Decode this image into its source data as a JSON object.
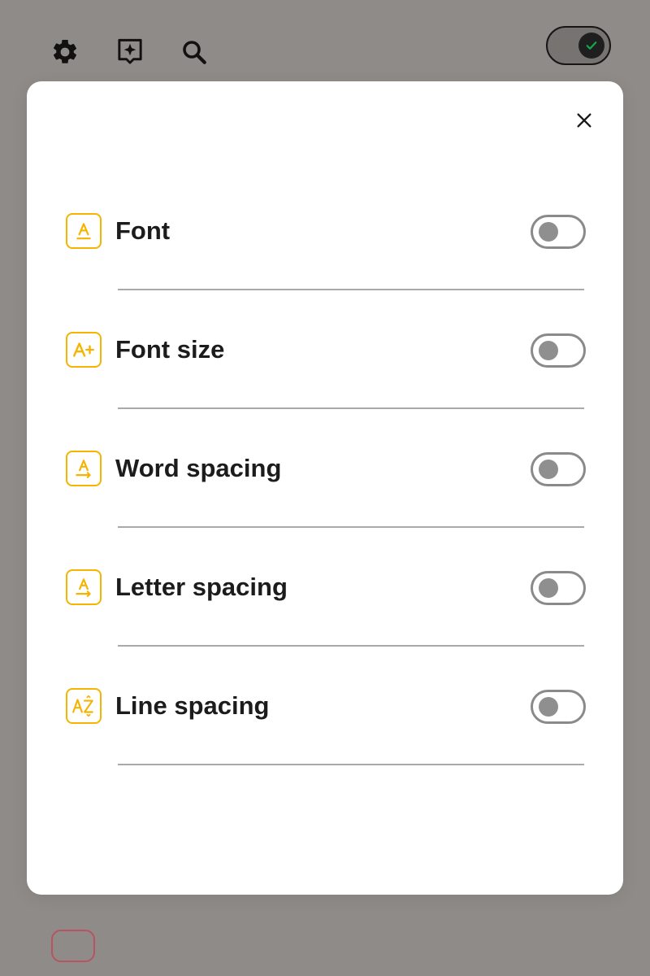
{
  "toolbar": {
    "icons": [
      "gear-icon",
      "ai-assist-icon",
      "search-icon"
    ],
    "toggle": {
      "state": "on",
      "icon": "check-icon"
    }
  },
  "modal": {
    "close_icon": "close-icon",
    "settings": [
      {
        "label": "Font",
        "icon": "font-icon",
        "enabled": false
      },
      {
        "label": "Font size",
        "icon": "font-size-icon",
        "enabled": false
      },
      {
        "label": "Word spacing",
        "icon": "word-spacing-icon",
        "enabled": false
      },
      {
        "label": "Letter spacing",
        "icon": "letter-spacing-icon",
        "enabled": false
      },
      {
        "label": "Line spacing",
        "icon": "line-spacing-icon",
        "enabled": false
      }
    ]
  },
  "colors": {
    "backdrop": "#8f8b88",
    "modal": "#ffffff",
    "accent": "#f4b400",
    "text": "#1c1c1c",
    "switch_off": "#8a8a8a"
  }
}
